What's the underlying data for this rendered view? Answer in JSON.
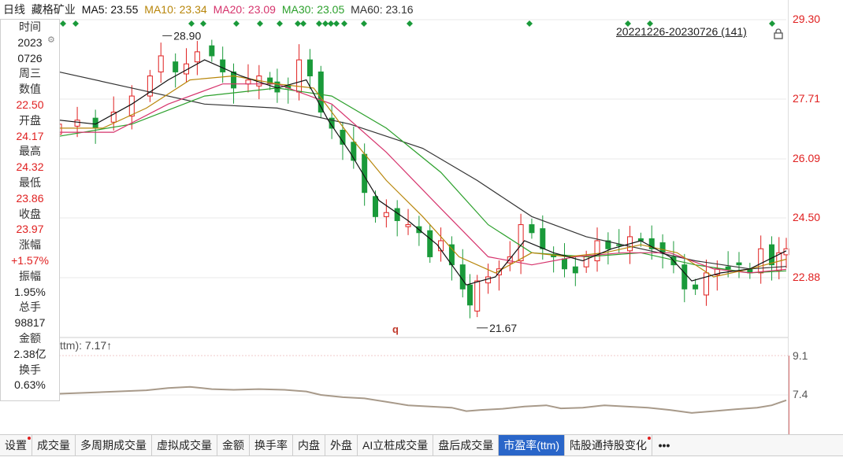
{
  "header": {
    "period": "日线",
    "stock_name": "藏格矿业",
    "ma5": "MA5: 23.55",
    "ma10": "MA10: 23.34",
    "ma20": "MA20: 23.09",
    "ma30": "MA30: 23.05",
    "ma60": "MA60: 23.16"
  },
  "range_label": "20221226-20230726 (141)",
  "info_panel": [
    {
      "label": "时间",
      "value": "2023"
    },
    {
      "label": "",
      "value": "0726"
    },
    {
      "label": "周三",
      "value": ""
    },
    {
      "label": "数值",
      "value": "22.50"
    },
    {
      "label": "开盘",
      "value": "24.17"
    },
    {
      "label": "最高",
      "value": "24.32"
    },
    {
      "label": "最低",
      "value": "23.86"
    },
    {
      "label": "收盘",
      "value": "23.97"
    },
    {
      "label": "涨幅",
      "value": "+1.57%"
    },
    {
      "label": "振幅",
      "value": "1.95%"
    },
    {
      "label": "总手",
      "value": "98817"
    },
    {
      "label": "金额",
      "value": "2.38亿"
    },
    {
      "label": "换手",
      "value": "0.63%"
    }
  ],
  "indicator_label": "ttm):",
  "indicator_value": "7.17↑",
  "annotations": {
    "high_label": "28.90",
    "low_label": "21.67",
    "q_marker": "q"
  },
  "tabs": [
    {
      "label": "设置",
      "dot": true
    },
    {
      "label": "成交量",
      "dot": false
    },
    {
      "label": "多周期成交量",
      "dot": false
    },
    {
      "label": "虚拟成交量",
      "dot": false
    },
    {
      "label": "金额",
      "dot": false
    },
    {
      "label": "换手率",
      "dot": false
    },
    {
      "label": "内盘",
      "dot": false
    },
    {
      "label": "外盘",
      "dot": false
    },
    {
      "label": "AI立桩成交量",
      "dot": false
    },
    {
      "label": "盘后成交量",
      "dot": false
    },
    {
      "label": "市盈率(ttm)",
      "dot": false,
      "active": true
    },
    {
      "label": "陆股通持股变化",
      "dot": true
    }
  ],
  "more_label": "•••",
  "colors": {
    "up": "#e02020",
    "down": "#1a9a3a",
    "ma5": "#111111",
    "ma10": "#b8860b",
    "ma20": "#d6336c",
    "ma30": "#2ca02c",
    "ma60": "#333333",
    "pe_line": "#a89a8a"
  },
  "chart_data": [
    {
      "type": "candlestick",
      "title": "",
      "ytick_labels": [
        "29.30",
        "27.71",
        "26.09",
        "24.50",
        "22.88"
      ],
      "ylim": [
        21.2,
        29.6
      ],
      "x_range_label": "20221226-20230726",
      "count": 141,
      "close_points": [
        [
          0,
          26.7
        ],
        [
          5,
          26.8
        ],
        [
          10,
          26.6
        ],
        [
          15,
          27.0
        ],
        [
          20,
          27.4
        ],
        [
          25,
          27.9
        ],
        [
          28,
          28.4
        ],
        [
          32,
          28.0
        ],
        [
          35,
          28.2
        ],
        [
          38,
          28.5
        ],
        [
          42,
          28.4
        ],
        [
          45,
          28.0
        ],
        [
          48,
          27.6
        ],
        [
          52,
          27.8
        ],
        [
          55,
          27.9
        ],
        [
          58,
          27.7
        ],
        [
          60,
          27.5
        ],
        [
          63,
          27.6
        ],
        [
          66,
          28.3
        ],
        [
          69,
          27.9
        ],
        [
          72,
          27.0
        ],
        [
          75,
          26.6
        ],
        [
          78,
          26.2
        ],
        [
          81,
          25.8
        ],
        [
          84,
          25.0
        ],
        [
          87,
          24.4
        ],
        [
          90,
          24.5
        ],
        [
          93,
          24.3
        ],
        [
          96,
          24.2
        ],
        [
          99,
          24.0
        ],
        [
          102,
          23.4
        ],
        [
          105,
          23.8
        ],
        [
          108,
          23.2
        ],
        [
          111,
          22.6
        ],
        [
          113,
          22.2
        ],
        [
          115,
          22.8
        ],
        [
          118,
          22.9
        ],
        [
          121,
          23.1
        ],
        [
          124,
          23.4
        ],
        [
          127,
          24.2
        ],
        [
          130,
          24.0
        ],
        [
          133,
          23.6
        ],
        [
          136,
          23.4
        ],
        [
          139,
          23.1
        ],
        [
          142,
          23.0
        ],
        [
          145,
          23.4
        ],
        [
          148,
          23.8
        ],
        [
          151,
          23.6
        ],
        [
          154,
          23.7
        ],
        [
          157,
          23.9
        ],
        [
          160,
          23.8
        ],
        [
          163,
          23.6
        ],
        [
          166,
          23.5
        ],
        [
          169,
          23.2
        ],
        [
          172,
          22.6
        ],
        [
          175,
          22.6
        ],
        [
          178,
          23.0
        ],
        [
          181,
          23.1
        ],
        [
          184,
          23.1
        ],
        [
          187,
          23.2
        ],
        [
          190,
          23.0
        ],
        [
          193,
          23.6
        ],
        [
          196,
          23.2
        ],
        [
          198,
          23.5
        ],
        [
          200,
          23.6
        ]
      ],
      "ma5_points": [
        [
          0,
          26.8
        ],
        [
          10,
          26.7
        ],
        [
          20,
          27.2
        ],
        [
          30,
          27.8
        ],
        [
          40,
          28.3
        ],
        [
          50,
          27.9
        ],
        [
          60,
          27.6
        ],
        [
          68,
          27.8
        ],
        [
          74,
          26.8
        ],
        [
          80,
          26.0
        ],
        [
          88,
          24.8
        ],
        [
          96,
          24.3
        ],
        [
          104,
          23.7
        ],
        [
          112,
          22.7
        ],
        [
          120,
          22.9
        ],
        [
          128,
          23.8
        ],
        [
          136,
          23.5
        ],
        [
          144,
          23.3
        ],
        [
          152,
          23.6
        ],
        [
          160,
          23.8
        ],
        [
          168,
          23.4
        ],
        [
          174,
          22.8
        ],
        [
          182,
          23.0
        ],
        [
          190,
          23.1
        ],
        [
          200,
          23.55
        ]
      ],
      "ma10_points": [
        [
          0,
          26.6
        ],
        [
          12,
          26.6
        ],
        [
          24,
          27.1
        ],
        [
          36,
          27.8
        ],
        [
          48,
          27.9
        ],
        [
          60,
          27.7
        ],
        [
          70,
          27.6
        ],
        [
          80,
          26.4
        ],
        [
          90,
          25.3
        ],
        [
          100,
          24.4
        ],
        [
          110,
          23.4
        ],
        [
          120,
          23.0
        ],
        [
          130,
          23.5
        ],
        [
          140,
          23.4
        ],
        [
          150,
          23.5
        ],
        [
          160,
          23.7
        ],
        [
          170,
          23.5
        ],
        [
          180,
          22.9
        ],
        [
          190,
          23.1
        ],
        [
          200,
          23.34
        ]
      ],
      "ma20_points": [
        [
          0,
          26.5
        ],
        [
          15,
          26.5
        ],
        [
          30,
          27.2
        ],
        [
          45,
          27.7
        ],
        [
          60,
          27.7
        ],
        [
          75,
          27.2
        ],
        [
          90,
          26.0
        ],
        [
          105,
          24.6
        ],
        [
          118,
          23.4
        ],
        [
          130,
          23.2
        ],
        [
          142,
          23.4
        ],
        [
          155,
          23.5
        ],
        [
          168,
          23.5
        ],
        [
          180,
          23.1
        ],
        [
          190,
          23.0
        ],
        [
          200,
          23.09
        ]
      ],
      "ma30_points": [
        [
          0,
          26.4
        ],
        [
          20,
          26.7
        ],
        [
          40,
          27.4
        ],
        [
          60,
          27.6
        ],
        [
          75,
          27.4
        ],
        [
          90,
          26.6
        ],
        [
          105,
          25.5
        ],
        [
          118,
          24.2
        ],
        [
          130,
          23.5
        ],
        [
          145,
          23.4
        ],
        [
          160,
          23.5
        ],
        [
          175,
          23.2
        ],
        [
          190,
          23.0
        ],
        [
          200,
          23.05
        ]
      ],
      "ma60_points": [
        [
          0,
          28.0
        ],
        [
          20,
          27.6
        ],
        [
          40,
          27.2
        ],
        [
          60,
          27.1
        ],
        [
          80,
          26.7
        ],
        [
          100,
          26.1
        ],
        [
          115,
          25.3
        ],
        [
          130,
          24.4
        ],
        [
          145,
          23.9
        ],
        [
          160,
          23.6
        ],
        [
          175,
          23.3
        ],
        [
          190,
          23.1
        ],
        [
          200,
          23.16
        ]
      ],
      "high_point": [
        28,
        28.9
      ],
      "low_point": [
        114,
        21.67
      ]
    },
    {
      "type": "line",
      "title": "",
      "ytick_labels": [
        "9.1",
        "7.4"
      ],
      "ylim": [
        6.4,
        9.4
      ],
      "points": [
        [
          0,
          7.45
        ],
        [
          8,
          7.5
        ],
        [
          16,
          7.55
        ],
        [
          24,
          7.6
        ],
        [
          30,
          7.7
        ],
        [
          36,
          7.75
        ],
        [
          42,
          7.65
        ],
        [
          48,
          7.62
        ],
        [
          55,
          7.65
        ],
        [
          62,
          7.62
        ],
        [
          68,
          7.55
        ],
        [
          72,
          7.4
        ],
        [
          78,
          7.3
        ],
        [
          84,
          7.25
        ],
        [
          90,
          7.1
        ],
        [
          96,
          6.95
        ],
        [
          102,
          6.9
        ],
        [
          108,
          6.85
        ],
        [
          112,
          6.7
        ],
        [
          116,
          6.75
        ],
        [
          122,
          6.8
        ],
        [
          128,
          6.9
        ],
        [
          134,
          6.95
        ],
        [
          138,
          6.82
        ],
        [
          144,
          6.85
        ],
        [
          150,
          6.95
        ],
        [
          156,
          6.9
        ],
        [
          162,
          6.85
        ],
        [
          168,
          6.75
        ],
        [
          174,
          6.62
        ],
        [
          180,
          6.7
        ],
        [
          186,
          6.78
        ],
        [
          192,
          6.85
        ],
        [
          196,
          6.95
        ],
        [
          200,
          7.17
        ]
      ]
    }
  ]
}
